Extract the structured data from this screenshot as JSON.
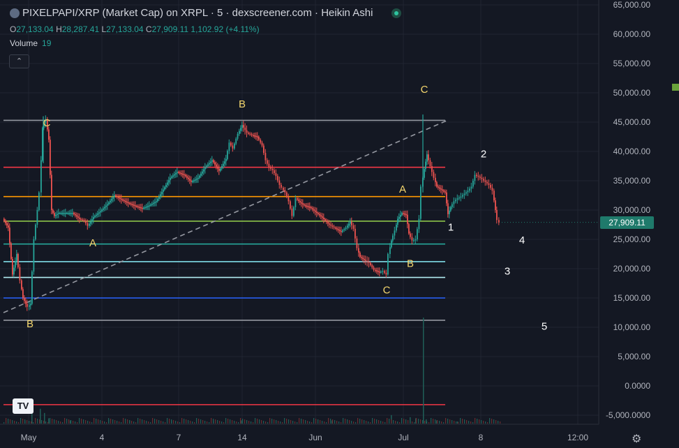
{
  "header": {
    "title": "PIXELPAPI/XRP (Market Cap) on XRPL · 5 · dexscreener.com · Heikin Ashi",
    "ohlc": {
      "o_key": "O",
      "o_val": "27,133.04",
      "h_key": "H",
      "h_val": "28,287.41",
      "l_key": "L",
      "l_val": "27,133.04",
      "c_key": "C",
      "c_val": "27,909.11",
      "change": "1,102.92 (+4.11%)"
    },
    "volume_label": "Volume",
    "volume_value": "19",
    "collapse_icon": "chevron-up-icon"
  },
  "price_tag": "27,909.11",
  "chart_data": {
    "type": "candlestick",
    "style": "Heikin Ashi",
    "interval": "5",
    "y_ticks": [
      "65,000.00",
      "60,000.00",
      "55,000.00",
      "50,000.00",
      "45,000.00",
      "40,000.00",
      "35,000.00",
      "30,000.00",
      "25,000.00",
      "20,000.00",
      "15,000.00",
      "10,000.00",
      "5,000.00",
      "0.0000",
      "-5,000.0000"
    ],
    "x_ticks": [
      "May",
      "4",
      "7",
      "14",
      "Jun",
      "Jul",
      "8",
      "12:00"
    ],
    "ylim": [
      -5500,
      65000
    ],
    "last_price": 27909.11,
    "price_series": [
      [
        0,
        28500
      ],
      [
        8,
        27000
      ],
      [
        14,
        19000
      ],
      [
        20,
        22500
      ],
      [
        25,
        18000
      ],
      [
        29,
        15000
      ],
      [
        33,
        14000
      ],
      [
        36,
        13500
      ],
      [
        40,
        14000
      ],
      [
        45,
        25000
      ],
      [
        50,
        30000
      ],
      [
        53,
        33000
      ],
      [
        57,
        44000
      ],
      [
        62,
        45500
      ],
      [
        66,
        42000
      ],
      [
        70,
        30000
      ],
      [
        74,
        29000
      ],
      [
        80,
        29500
      ],
      [
        90,
        29500
      ],
      [
        100,
        29500
      ],
      [
        110,
        28500
      ],
      [
        117,
        28200
      ],
      [
        122,
        27300
      ],
      [
        130,
        28800
      ],
      [
        140,
        29800
      ],
      [
        150,
        31000
      ],
      [
        160,
        32500
      ],
      [
        170,
        31800
      ],
      [
        180,
        31200
      ],
      [
        190,
        30700
      ],
      [
        200,
        30300
      ],
      [
        210,
        30800
      ],
      [
        220,
        31500
      ],
      [
        230,
        33500
      ],
      [
        240,
        35500
      ],
      [
        250,
        36500
      ],
      [
        260,
        36000
      ],
      [
        270,
        34800
      ],
      [
        280,
        35500
      ],
      [
        290,
        37300
      ],
      [
        300,
        38500
      ],
      [
        310,
        36700
      ],
      [
        320,
        38700
      ],
      [
        325,
        41500
      ],
      [
        330,
        40500
      ],
      [
        337,
        43000
      ],
      [
        343,
        44500
      ],
      [
        350,
        43200
      ],
      [
        357,
        42800
      ],
      [
        365,
        42500
      ],
      [
        372,
        41000
      ],
      [
        377,
        38500
      ],
      [
        382,
        37300
      ],
      [
        387,
        36800
      ],
      [
        392,
        35800
      ],
      [
        397,
        34300
      ],
      [
        400,
        33800
      ],
      [
        405,
        33000
      ],
      [
        410,
        31500
      ],
      [
        415,
        29000
      ],
      [
        420,
        32000
      ],
      [
        426,
        31300
      ],
      [
        432,
        30800
      ],
      [
        440,
        30500
      ],
      [
        450,
        29500
      ],
      [
        458,
        28700
      ],
      [
        466,
        27700
      ],
      [
        475,
        27000
      ],
      [
        485,
        26300
      ],
      [
        492,
        27000
      ],
      [
        498,
        28000
      ],
      [
        503,
        26800
      ],
      [
        508,
        23500
      ],
      [
        512,
        22000
      ],
      [
        518,
        21500
      ],
      [
        525,
        21000
      ],
      [
        532,
        19800
      ],
      [
        540,
        19400
      ],
      [
        545,
        19600
      ],
      [
        550,
        19000
      ],
      [
        553,
        22500
      ],
      [
        557,
        24800
      ],
      [
        562,
        26500
      ],
      [
        566,
        28500
      ],
      [
        572,
        29500
      ],
      [
        578,
        29200
      ],
      [
        582,
        26000
      ],
      [
        587,
        24800
      ],
      [
        592,
        25000
      ],
      [
        597,
        28500
      ],
      [
        600,
        34000
      ],
      [
        604,
        37000
      ],
      [
        608,
        39500
      ],
      [
        613,
        37500
      ],
      [
        618,
        35500
      ],
      [
        622,
        34000
      ],
      [
        628,
        33500
      ],
      [
        634,
        33000
      ],
      [
        638,
        29300
      ],
      [
        642,
        30500
      ],
      [
        647,
        31500
      ],
      [
        652,
        32000
      ],
      [
        657,
        32300
      ],
      [
        662,
        32800
      ],
      [
        667,
        33300
      ],
      [
        672,
        34000
      ],
      [
        677,
        36000
      ],
      [
        682,
        35700
      ],
      [
        687,
        35300
      ],
      [
        692,
        34800
      ],
      [
        697,
        34300
      ],
      [
        702,
        33300
      ],
      [
        706,
        30000
      ],
      [
        709,
        28300
      ],
      [
        712,
        27909
      ]
    ],
    "volume_spikes": [
      [
        30,
        3
      ],
      [
        40,
        9
      ],
      [
        52,
        14
      ],
      [
        58,
        10
      ],
      [
        64,
        5
      ],
      [
        95,
        3
      ],
      [
        150,
        4
      ],
      [
        180,
        3
      ],
      [
        240,
        3
      ],
      [
        300,
        3
      ],
      [
        340,
        3
      ],
      [
        470,
        3
      ],
      [
        555,
        8
      ],
      [
        582,
        6
      ],
      [
        590,
        5
      ],
      [
        601,
        100
      ],
      [
        605,
        4
      ],
      [
        620,
        3
      ],
      [
        650,
        2
      ]
    ],
    "horizontal_levels": [
      {
        "price": 45300,
        "color": "#9598a1",
        "label": "gray-top"
      },
      {
        "price": 37300,
        "color": "#f23645",
        "label": "red"
      },
      {
        "price": 32300,
        "color": "#ff9800",
        "label": "orange"
      },
      {
        "price": 28100,
        "color": "#8bc34a",
        "label": "green"
      },
      {
        "price": 24200,
        "color": "#26a69a",
        "label": "teal"
      },
      {
        "price": 21200,
        "color": "#80deea",
        "label": "light-blue"
      },
      {
        "price": 18500,
        "color": "#b2ebf2",
        "label": "pale-blue"
      },
      {
        "price": 15000,
        "color": "#2962ff",
        "label": "blue"
      },
      {
        "price": 11200,
        "color": "#9598a1",
        "label": "gray-bottom"
      },
      {
        "price": -3200,
        "color": "#f23645",
        "label": "red-bottom"
      }
    ],
    "trendline": {
      "from": [
        0,
        12500
      ],
      "to": [
        638,
        45400
      ],
      "color": "#9598a1",
      "style": "dashed"
    },
    "wave_labels": [
      {
        "text": "C",
        "x": 62,
        "price": 44300,
        "color": "#f5d76e"
      },
      {
        "text": "B",
        "x": 38,
        "price": 10000,
        "color": "#f5d76e"
      },
      {
        "text": "A",
        "x": 128,
        "price": 23800,
        "color": "#f5d76e"
      },
      {
        "text": "B",
        "x": 342,
        "price": 47500,
        "color": "#f5d76e"
      },
      {
        "text": "A",
        "x": 572,
        "price": 33000,
        "color": "#f5d76e"
      },
      {
        "text": "B",
        "x": 583,
        "price": 20300,
        "color": "#f5d76e"
      },
      {
        "text": "C",
        "x": 549,
        "price": 15800,
        "color": "#f5d76e"
      },
      {
        "text": "C",
        "x": 603,
        "price": 50000,
        "color": "#f5d76e"
      },
      {
        "text": "1",
        "x": 641,
        "price": 26500,
        "color": "#ffffff"
      },
      {
        "text": "2",
        "x": 688,
        "price": 39000,
        "color": "#ffffff"
      },
      {
        "text": "4",
        "x": 743,
        "price": 24300,
        "color": "#ffffff"
      },
      {
        "text": "3",
        "x": 722,
        "price": 19000,
        "color": "#ffffff"
      },
      {
        "text": "5",
        "x": 775,
        "price": 9600,
        "color": "#ffffff"
      }
    ]
  },
  "colors": {
    "background": "#141823",
    "grid": "#202532",
    "candle_up": "#26a69a",
    "candle_down": "#ef5350",
    "axis_text": "#b2b5be"
  },
  "icons": {
    "logo": "pixelpapi-token-icon",
    "status": "market-open-dot-icon",
    "tradingview": "tradingview-logo-icon",
    "settings": "gear-icon"
  },
  "tv_logo_text": "TV"
}
